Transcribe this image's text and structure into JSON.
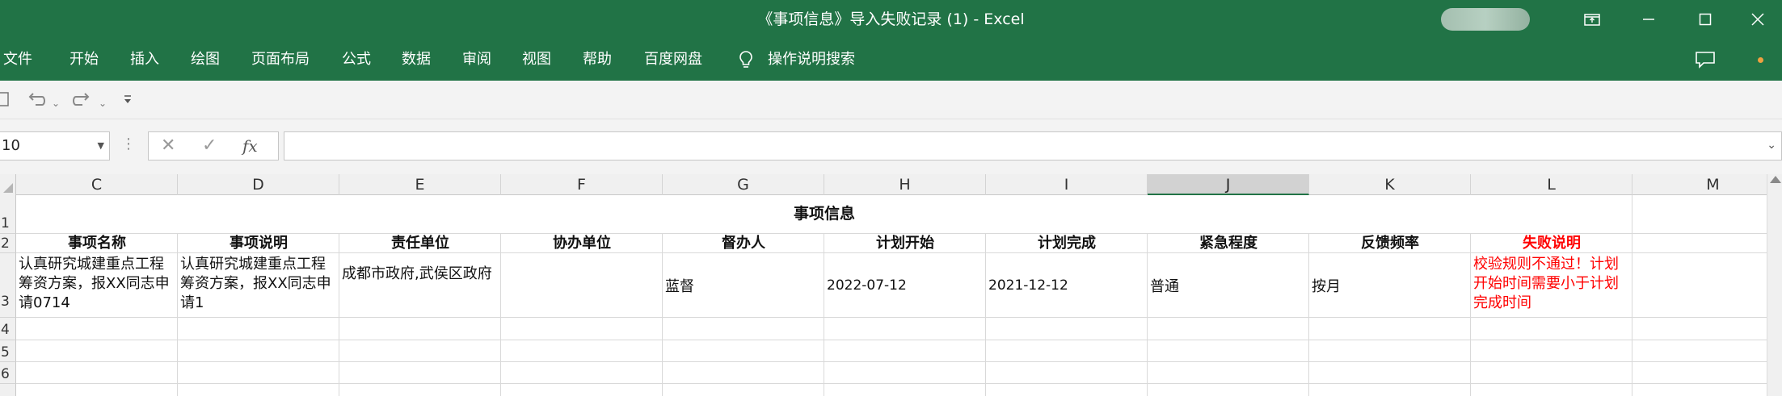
{
  "window": {
    "title": "《事项信息》导入失败记录 (1)  -  Excel"
  },
  "ribbon": {
    "tabs": [
      "文件",
      "开始",
      "插入",
      "绘图",
      "页面布局",
      "公式",
      "数据",
      "审阅",
      "视图",
      "帮助",
      "百度网盘"
    ],
    "search_label": "操作说明搜索"
  },
  "formula_bar": {
    "name_box": "10",
    "formula": ""
  },
  "columns": [
    "C",
    "D",
    "E",
    "F",
    "G",
    "H",
    "I",
    "J",
    "K",
    "L",
    "M"
  ],
  "selected_column": "J",
  "rows": [
    "1",
    "2",
    "3",
    "4",
    "5",
    "6"
  ],
  "sheet": {
    "title": "事项信息",
    "headers": [
      "事项名称",
      "事项说明",
      "责任单位",
      "协办单位",
      "督办人",
      "计划开始",
      "计划完成",
      "紧急程度",
      "反馈频率",
      "失败说明"
    ],
    "record": {
      "name": "认真研究城建重点工程筹资方案，报XX同志申请0714",
      "description": "认真研究城建重点工程筹资方案，报XX同志申请1",
      "responsible_unit": "成都市政府,武侯区政府",
      "co_unit": "",
      "supervisor": "蓝督",
      "plan_start": "2022-07-12",
      "plan_end": "2021-12-12",
      "urgency": "普通",
      "feedback_frequency": "按月",
      "failure_reason": "校验规则不通过！计划开始时间需要小于计划完成时间"
    }
  },
  "colors": {
    "excel_green": "#217346",
    "error_red": "#ff0000"
  }
}
